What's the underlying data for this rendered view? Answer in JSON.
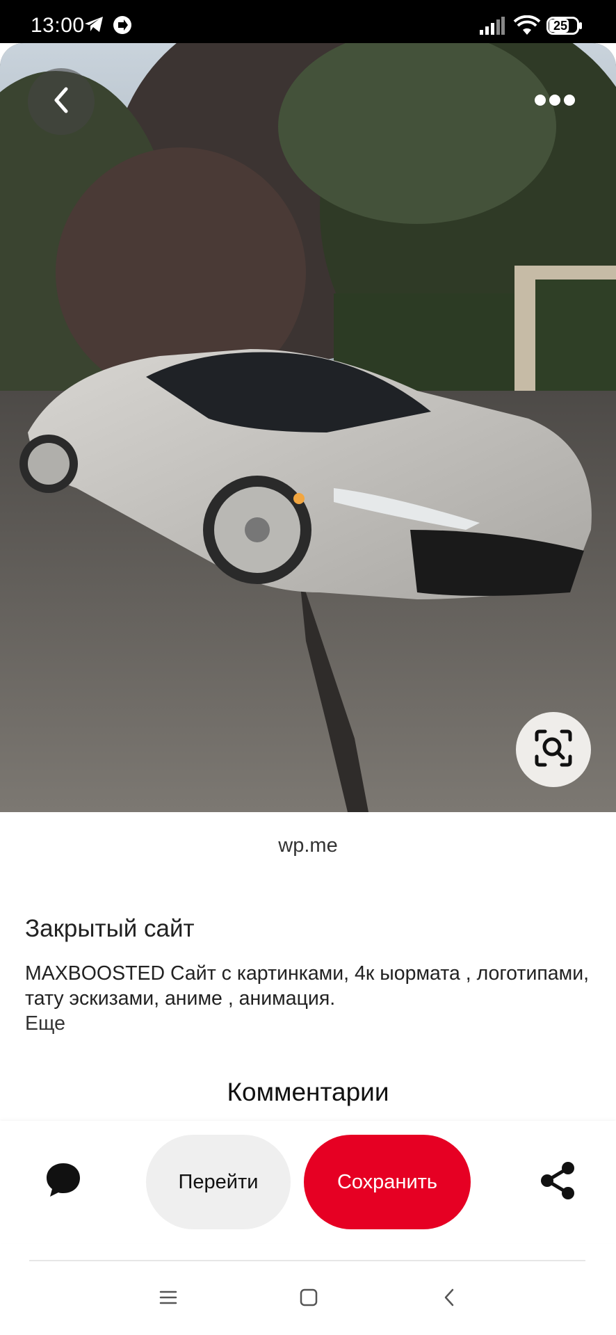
{
  "status_bar": {
    "time": "13:00",
    "battery": "25"
  },
  "pin": {
    "source_domain": "wp.me",
    "title": "Закрытый сайт",
    "description": "MAXBOOSTED Сайт с картинками, 4к ыормата , логотипами, тату эскизами, аниме , анимация.",
    "more_label": "Еще",
    "comments_heading": "Комментарии"
  },
  "actions": {
    "visit_label": "Перейти",
    "save_label": "Сохранить"
  },
  "colors": {
    "save_button": "#e60023",
    "visit_button": "#efefef"
  },
  "icons": {
    "back": "chevron-left-icon",
    "more": "more-dots-icon",
    "lens": "visual-search-icon",
    "comment": "comment-bubble-icon",
    "share": "share-icon"
  }
}
